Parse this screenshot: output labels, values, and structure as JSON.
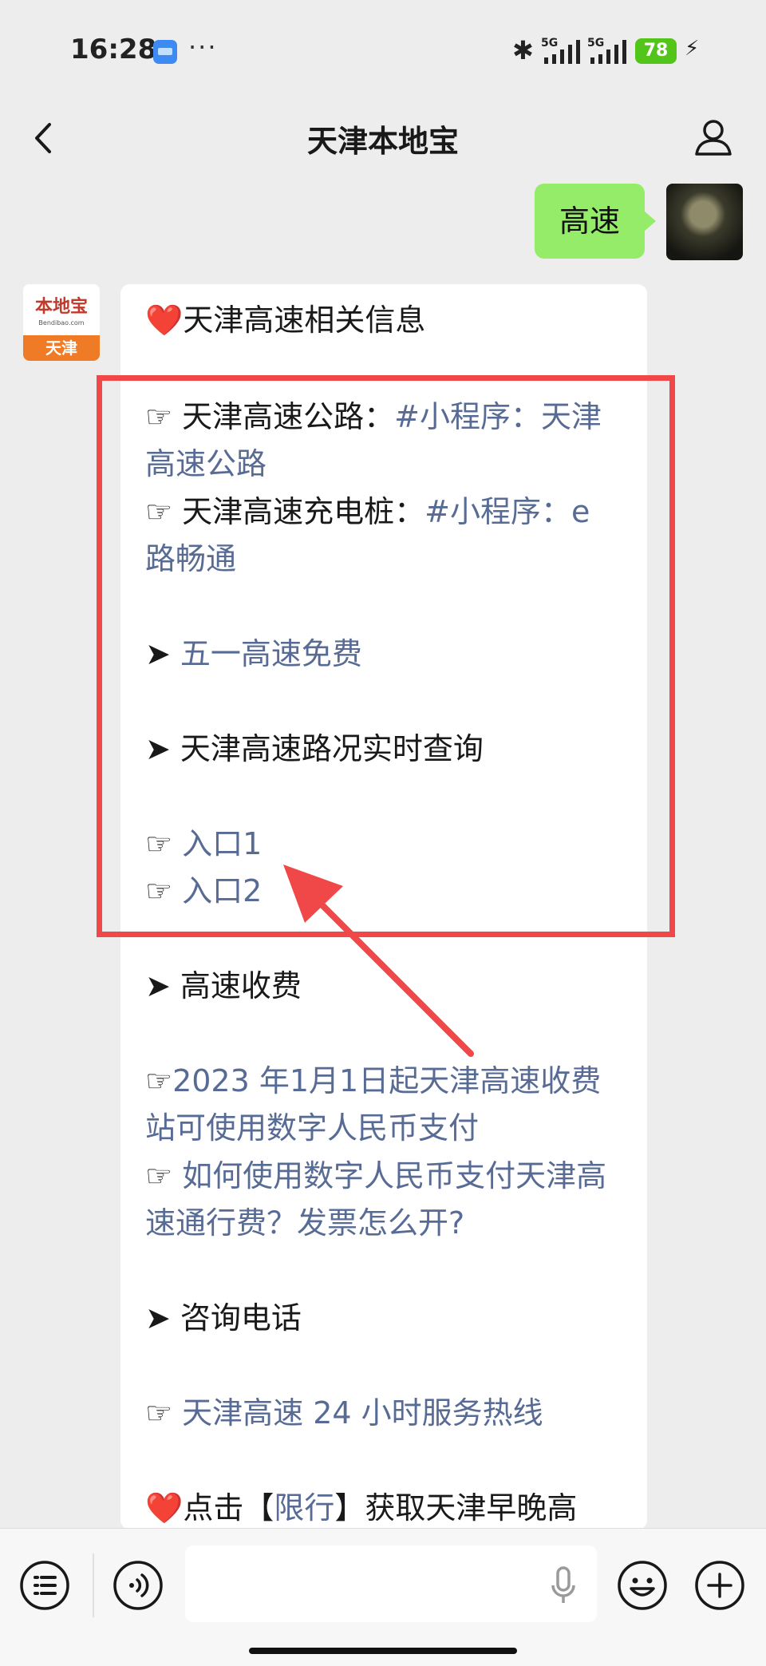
{
  "status_bar": {
    "time": "16:28",
    "more": "···",
    "network_1": "5G",
    "network_2": "5G",
    "battery": "78"
  },
  "nav": {
    "title": "天津本地宝",
    "back_icon": "chevron-left-icon",
    "profile_icon": "person-icon"
  },
  "chat": {
    "user_message": "高速",
    "bot_avatar": {
      "logo_text": "本地宝",
      "site": "Bendibao.com",
      "city": "天津"
    },
    "bot_message": {
      "l1": {
        "emoji": "❤️",
        "text": "天津高速相关信息"
      },
      "l2": {
        "prefix": "☞ ",
        "text": "天津高速公路：",
        "link": "#小程序：天津"
      },
      "l3": {
        "link": "高速公路"
      },
      "l4": {
        "prefix": "☞ ",
        "text": "天津高速充电桩：",
        "link": "#小程序：e"
      },
      "l5": {
        "link": "路畅通"
      },
      "l6": {
        "prefix": "➤ ",
        "link": "五一高速免费"
      },
      "l7": {
        "prefix": "➤ ",
        "text": "天津高速路况实时查询"
      },
      "l8": {
        "prefix": "☞ ",
        "link": "入口1"
      },
      "l9": {
        "prefix": "☞ ",
        "link": "入口2"
      },
      "l10": {
        "prefix": "➤ ",
        "text": "高速收费"
      },
      "l11": {
        "prefix": "☞",
        "link": "2023 年1月1日起天津高速收费"
      },
      "l12": {
        "link": "站可使用数字人民币支付"
      },
      "l13": {
        "prefix": "☞ ",
        "link": "如何使用数字人民币支付天津高"
      },
      "l14": {
        "link": "速通行费？发票怎么开?"
      },
      "l15": {
        "prefix": "➤ ",
        "text": "咨询电话"
      },
      "l16": {
        "prefix": "☞ ",
        "link": "天津高速 24 小时服务热线"
      },
      "l17": {
        "emoji": "❤️",
        "text_a": "点击【",
        "link": "限行",
        "text_b": "】获取天津早晚高"
      }
    }
  },
  "input_bar": {
    "menu_icon": "menu-list-icon",
    "voice_icon": "voice-icon",
    "mic_icon": "microphone-icon",
    "emoji_icon": "emoji-icon",
    "add_icon": "plus-icon"
  },
  "colors": {
    "link": "#576b95",
    "user_bubble": "#95ec69",
    "highlight": "#f04848",
    "background": "#ededed"
  }
}
